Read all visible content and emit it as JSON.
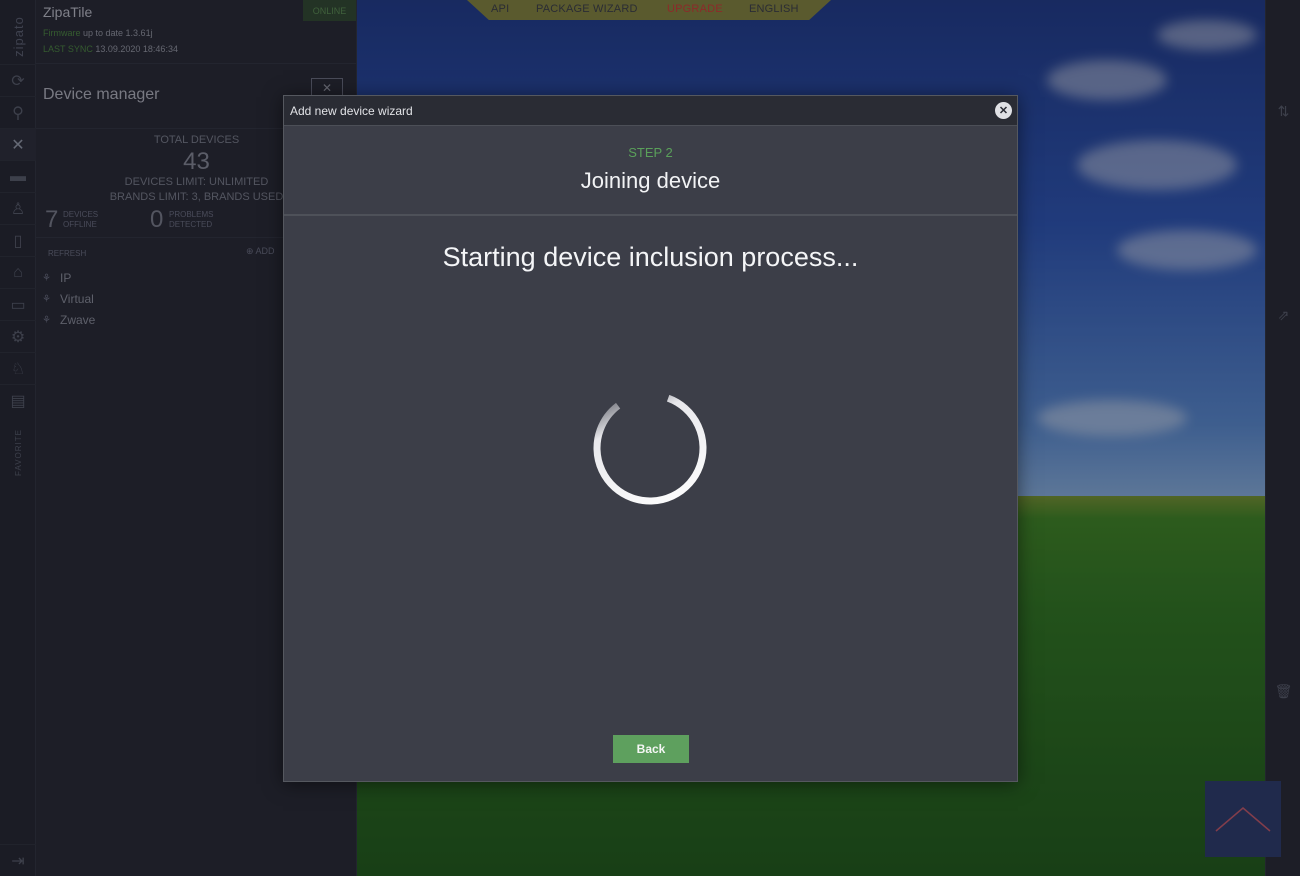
{
  "app": {
    "title": "ZipaTile",
    "logo_text": "zipato",
    "status": "ONLINE",
    "firmware_label": "Firmware",
    "firmware_text": "up to date 1.3.61j",
    "last_sync_label": "LAST SYNC",
    "last_sync_value": "13.09.2020 18:46:34"
  },
  "topnav": {
    "items": [
      "API",
      "PACKAGE WIZARD",
      "UPGRADE",
      "ENGLISH"
    ]
  },
  "rail": {
    "icons": [
      "sync-icon",
      "search-icon",
      "devices-icon",
      "media-icon",
      "users-icon",
      "phone-icon",
      "alarm-icon",
      "folder-icon",
      "settings-icon",
      "rules-icon",
      "calendar-icon"
    ],
    "favorite_label": "FAVORITE"
  },
  "panel": {
    "title": "Device manager",
    "total_devices_label": "TOTAL DEVICES",
    "total_devices": "43",
    "devices_limit": "DEVICES LIMIT: UNLIMITED",
    "brands_limit": "BRANDS LIMIT: 3, BRANDS USED",
    "offline_count": "7",
    "offline_label_1": "DEVICES",
    "offline_label_2": "OFFLINE",
    "problems_count": "0",
    "problems_label_1": "PROBLEMS",
    "problems_label_2": "DETECTED",
    "refresh_label": "REFRESH",
    "add_label": "ADD",
    "tree": [
      "IP",
      "Virtual",
      "Zwave"
    ]
  },
  "modal": {
    "title": "Add new device wizard",
    "step": "STEP 2",
    "step_title": "Joining device",
    "message": "Starting device inclusion process...",
    "back_label": "Back"
  },
  "colors": {
    "accent_green": "#5ea05e",
    "upgrade_red": "#8c2a2a",
    "modal_bg": "#3c3e48"
  }
}
